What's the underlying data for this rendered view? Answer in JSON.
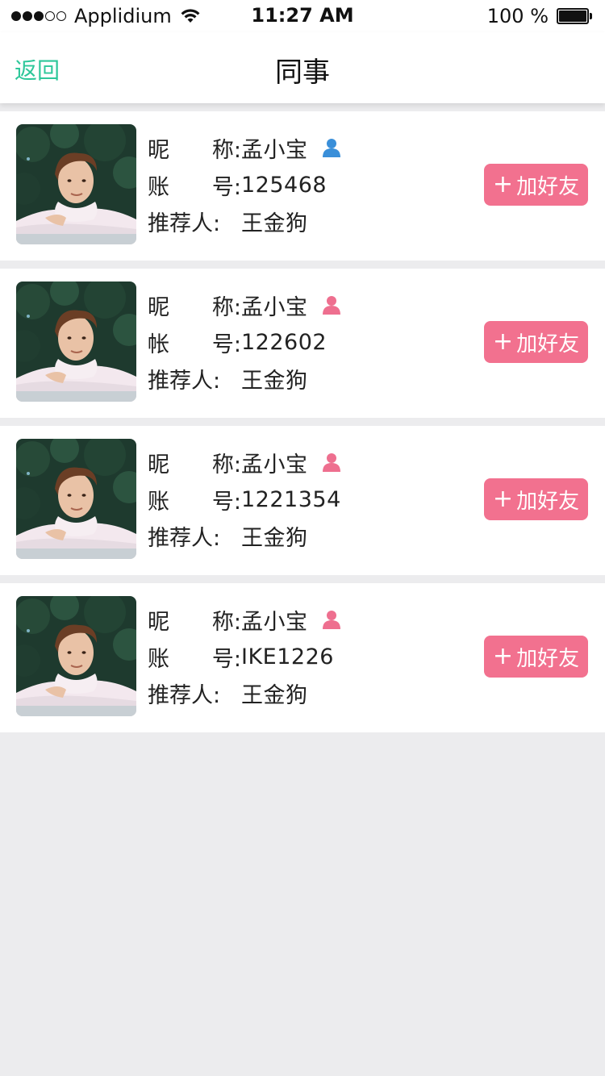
{
  "status_bar": {
    "carrier": "Applidium",
    "time": "11:27 AM",
    "battery": "100 %"
  },
  "nav": {
    "back_label": "返回",
    "title": "同事"
  },
  "labels": {
    "nickname_char1": "昵",
    "nickname_char2": "称:",
    "account_char2": "号:",
    "referrer": "推荐人:"
  },
  "add_friend": {
    "plus": "+",
    "label": "加好友"
  },
  "colors": {
    "accent_green": "#2ec79a",
    "button_pink": "#f2718f",
    "male_icon_blue": "#3a8fd9",
    "female_icon_pink": "#ee6f8f"
  },
  "colleagues": [
    {
      "nickname": "孟小宝",
      "account_label_char1": "账",
      "account": "125468",
      "referrer": "王金狗",
      "gender_icon": "person-icon-blue"
    },
    {
      "nickname": "孟小宝",
      "account_label_char1": "帐",
      "account": "122602",
      "referrer": "王金狗",
      "gender_icon": "person-icon-pink"
    },
    {
      "nickname": "孟小宝",
      "account_label_char1": "账",
      "account": "1221354",
      "referrer": "王金狗",
      "gender_icon": "person-icon-pink"
    },
    {
      "nickname": "孟小宝",
      "account_label_char1": "账",
      "account": "IKE1226",
      "referrer": "王金狗",
      "gender_icon": "person-icon-pink"
    }
  ]
}
